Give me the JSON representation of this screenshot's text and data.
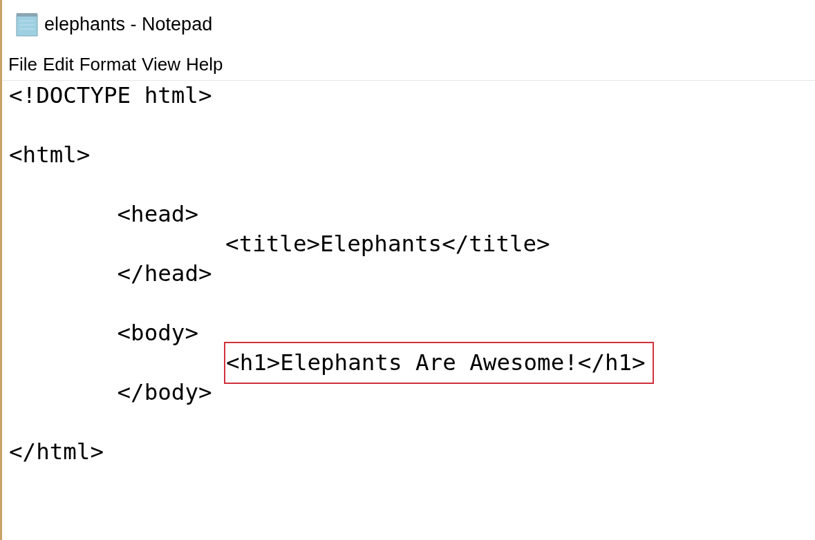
{
  "window": {
    "title": "elephants - Notepad"
  },
  "menu": [
    "File",
    "Edit",
    "Format",
    "View",
    "Help"
  ],
  "lines": [
    {
      "kind": "code",
      "text": "<!DOCTYPE html>",
      "highlighted": false
    },
    {
      "kind": "blank"
    },
    {
      "kind": "code",
      "text": "<html>",
      "highlighted": false
    },
    {
      "kind": "blank"
    },
    {
      "kind": "code",
      "text": "\t<head>",
      "highlighted": false
    },
    {
      "kind": "code",
      "text": "\t\t<title>Elephants</title>",
      "highlighted": false
    },
    {
      "kind": "code",
      "text": "\t</head>",
      "highlighted": false
    },
    {
      "kind": "blank"
    },
    {
      "kind": "code",
      "text": "\t<body>",
      "highlighted": false
    },
    {
      "kind": "code",
      "text": "\t\t<h1>Elephants Are Awesome!</h1>",
      "highlighted": true
    },
    {
      "kind": "code",
      "text": "\t</body>",
      "highlighted": false
    },
    {
      "kind": "blank"
    },
    {
      "kind": "code",
      "text": "</html>",
      "highlighted": false
    }
  ]
}
